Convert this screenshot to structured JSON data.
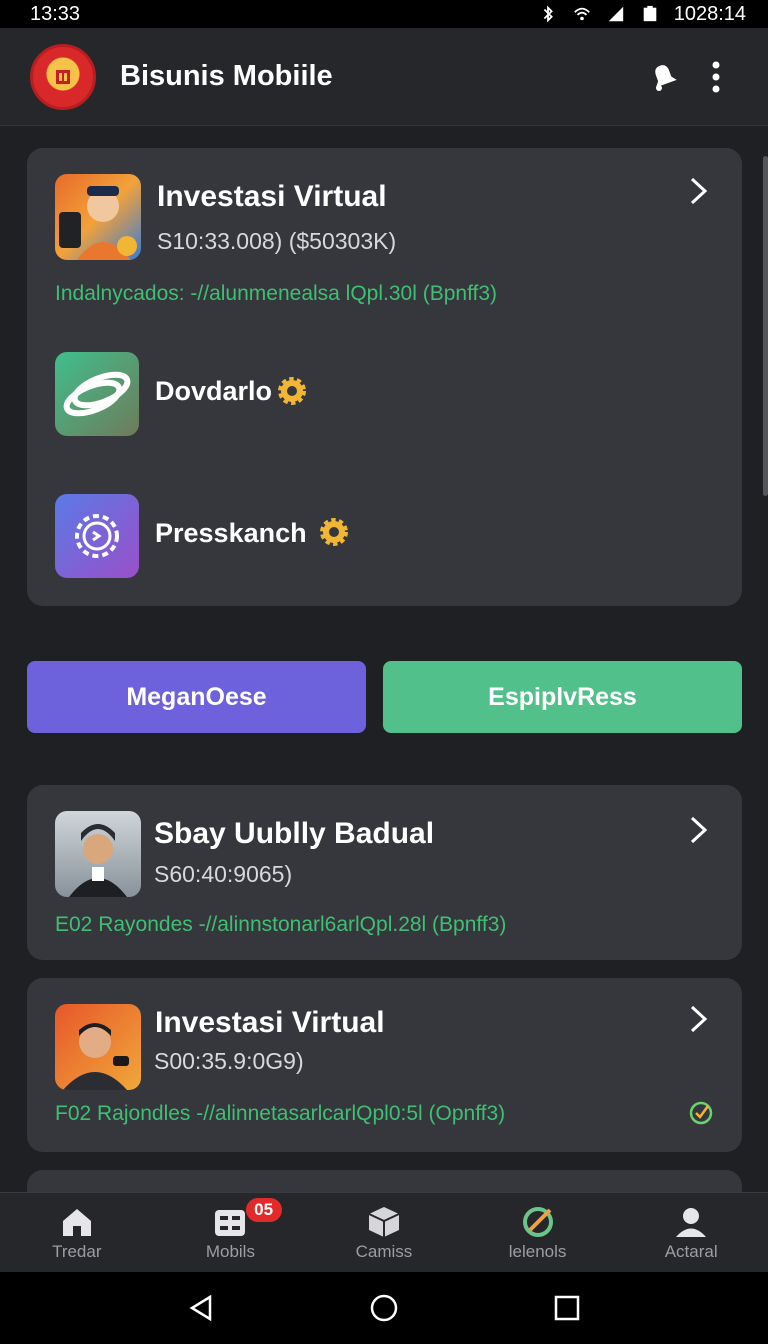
{
  "status": {
    "time": "13:33",
    "clock": "1028:14"
  },
  "app": {
    "title": "Bisunis Mobiile"
  },
  "card1": {
    "title": "Investasi Virtual",
    "subtitle": "S10:33.008)   ($50303K)",
    "line": "Indalnycados: -//alunmenealsa lQpl.30l  (Bpnff3)"
  },
  "items": [
    {
      "label": "Dovdarlo"
    },
    {
      "label": "Presskanch"
    }
  ],
  "buttons": {
    "primary": "MeganOese",
    "secondary": "EspiplvRess"
  },
  "card2": {
    "title": "Sbay Uublly Badual",
    "subtitle": "S60:40:9065)",
    "line": "E02 Rayondes -//alinnstonarl6arlQpl.28l  (Bpnff3)"
  },
  "card3": {
    "title": "Investasi Virtual",
    "subtitle": "S00:35.9:0G9)",
    "line": "F02 Rajondles -//alinnetasarlcarlQpl0:5l  (Opnff3)"
  },
  "nav": [
    {
      "label": "Tredar",
      "icon": "home-icon"
    },
    {
      "label": "Mobils",
      "icon": "grid-icon",
      "badge": "05"
    },
    {
      "label": "Camiss",
      "icon": "box-icon"
    },
    {
      "label": "lelenols",
      "icon": "compass-icon"
    },
    {
      "label": "Actaral",
      "icon": "person-icon"
    }
  ],
  "colors": {
    "primary_button": "#6e62dc",
    "secondary_button": "#52c08a",
    "accent_green": "#3fbf74",
    "badge": "#e32a2a"
  }
}
